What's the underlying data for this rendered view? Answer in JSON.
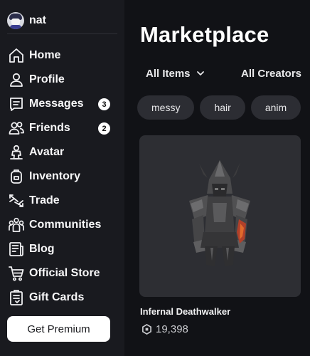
{
  "user": {
    "name": "nat"
  },
  "nav": {
    "items": [
      {
        "label": "Home",
        "icon": "home-icon"
      },
      {
        "label": "Profile",
        "icon": "profile-icon"
      },
      {
        "label": "Messages",
        "icon": "messages-icon",
        "badge": "3"
      },
      {
        "label": "Friends",
        "icon": "friends-icon",
        "badge": "2"
      },
      {
        "label": "Avatar",
        "icon": "avatar-icon"
      },
      {
        "label": "Inventory",
        "icon": "inventory-icon"
      },
      {
        "label": "Trade",
        "icon": "trade-icon"
      },
      {
        "label": "Communities",
        "icon": "communities-icon"
      },
      {
        "label": "Blog",
        "icon": "blog-icon"
      },
      {
        "label": "Official Store",
        "icon": "cart-icon"
      },
      {
        "label": "Gift Cards",
        "icon": "gift-card-icon"
      }
    ]
  },
  "premium": {
    "label": "Get Premium"
  },
  "main": {
    "title": "Marketplace",
    "filters": {
      "items_label": "All Items",
      "creators_label": "All Creators"
    },
    "chips": [
      "messy",
      "hair",
      "anim"
    ],
    "item": {
      "name": "Infernal Deathwalker",
      "price": "19,398",
      "currency_icon": "robux-icon"
    }
  },
  "colors": {
    "sidebar_bg": "#191a1f",
    "main_bg": "#111216",
    "chip_bg": "#2c2d33",
    "card_bg": "#2d2e33"
  }
}
